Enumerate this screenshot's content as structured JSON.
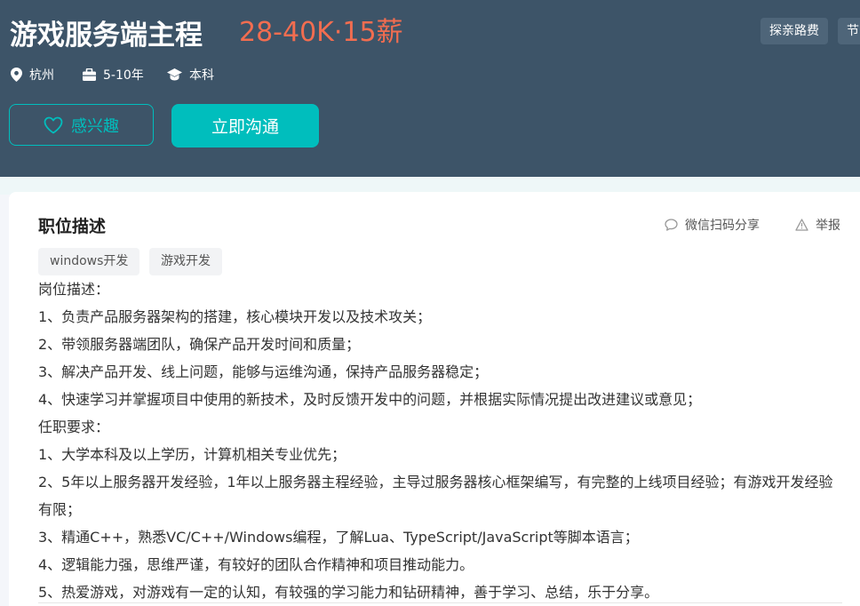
{
  "header": {
    "title": "游戏服务端主程",
    "salary": "28-40K·15薪",
    "benefits": [
      "探亲路费",
      "节"
    ],
    "meta": {
      "city": "杭州",
      "experience": "5-10年",
      "degree": "本科"
    },
    "interest_label": "感兴趣",
    "chat_label": "立即沟通"
  },
  "detail": {
    "section_title": "职位描述",
    "share_label": "微信扫码分享",
    "report_label": "举报",
    "skills": [
      "windows开发",
      "游戏开发"
    ],
    "lines": [
      "岗位描述：",
      "1、负责产品服务器架构的搭建，核心模块开发以及技术攻关；",
      "2、带领服务器端团队，确保产品开发时间和质量；",
      "3、解决产品开发、线上问题，能够与运维沟通，保持产品服务器稳定；",
      "4、快速学习并掌握项目中使用的新技术，及时反馈开发中的问题，并根据实际情况提出改进建议或意见；",
      "任职要求：",
      "1、大学本科及以上学历，计算机相关专业优先；",
      "2、5年以上服务器开发经验，1年以上服务器主程经验，主导过服务器核心框架编写，有完整的上线项目经验；有游戏开发经验有限；",
      "3、精通C++，熟悉VC/C++/Windows编程，了解Lua、TypeScript/JavaScript等脚本语言；",
      "4、逻辑能力强，思维严谨，有较好的团队合作精神和项目推动能力。",
      "5、热爱游戏，对游戏有一定的认知，有较强的学习能力和钻研精神，善于学习、总结，乐于分享。"
    ]
  },
  "colors": {
    "header_bg": "#3d5468",
    "accent": "#00bebd",
    "salary": "#f26d50"
  },
  "icons": {
    "city": "location-pin-icon",
    "experience": "briefcase-icon",
    "degree": "graduation-cap-icon",
    "interest": "heart-icon",
    "share": "chat-bubble-icon",
    "report": "warning-triangle-icon"
  }
}
